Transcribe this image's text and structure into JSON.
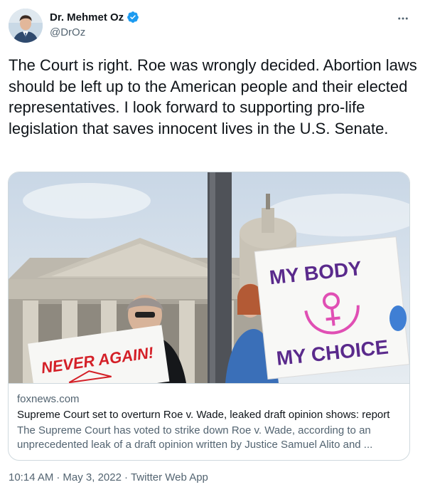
{
  "user": {
    "display_name": "Dr. Mehmet Oz",
    "handle": "@DrOz",
    "verified": true,
    "avatar_icon": "person-avatar"
  },
  "tweet": {
    "text": "The Court is right. Roe was wrongly decided. Abortion laws should be left up to the American people and their elected representatives. I look forward to supporting pro-life legislation that saves innocent lives in the U.S. Senate."
  },
  "card": {
    "domain": "foxnews.com",
    "title": "Supreme Court set to overturn Roe v. Wade, leaked draft opinion shows: report",
    "description": "The Supreme Court has voted to strike down Roe v. Wade, according to an unprecedented leak of a draft opinion written by Justice Samuel Alito and ...",
    "image": {
      "sign_left_text": "NEVER AGAIN!",
      "sign_right_line1": "MY BODY",
      "sign_right_line2": "MY CHOICE"
    }
  },
  "meta": {
    "time": "10:14 AM",
    "separator1": "·",
    "date": "May 3, 2022",
    "separator2": "·",
    "app": "Twitter Web App"
  },
  "colors": {
    "verified_blue": "#1d9bf0",
    "text_primary": "#0f1419",
    "text_secondary": "#536471",
    "border": "#cfd9de"
  }
}
